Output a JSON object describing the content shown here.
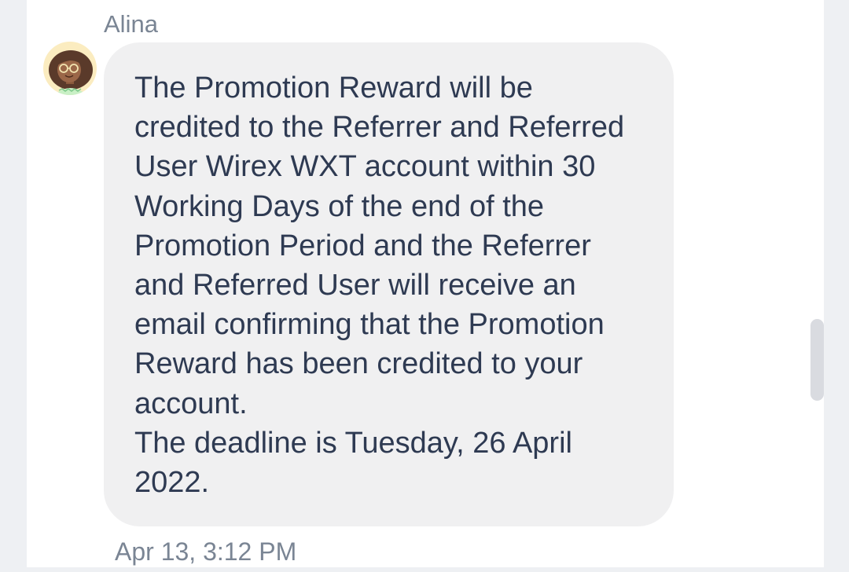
{
  "message": {
    "sender": "Alina",
    "lines": [
      "The Promotion Reward will be",
      "credited to the Referrer and Referred",
      "User Wirex WXT account within 30",
      "Working Days of the end of the",
      "Promotion Period and the Referrer",
      "and Referred User will receive an",
      "email confirming that the Promotion",
      "Reward has been credited to your",
      "account.",
      "The deadline is Tuesday, 26 April",
      "2022."
    ],
    "timestamp": "Apr 13, 3:12 PM",
    "avatar_icon": "woman-with-glasses-avatar"
  },
  "colors": {
    "bubble_bg": "#f0f0f1",
    "text": "#2e3a52",
    "meta_text": "#7a8594",
    "page_bg": "#eef0f3"
  }
}
